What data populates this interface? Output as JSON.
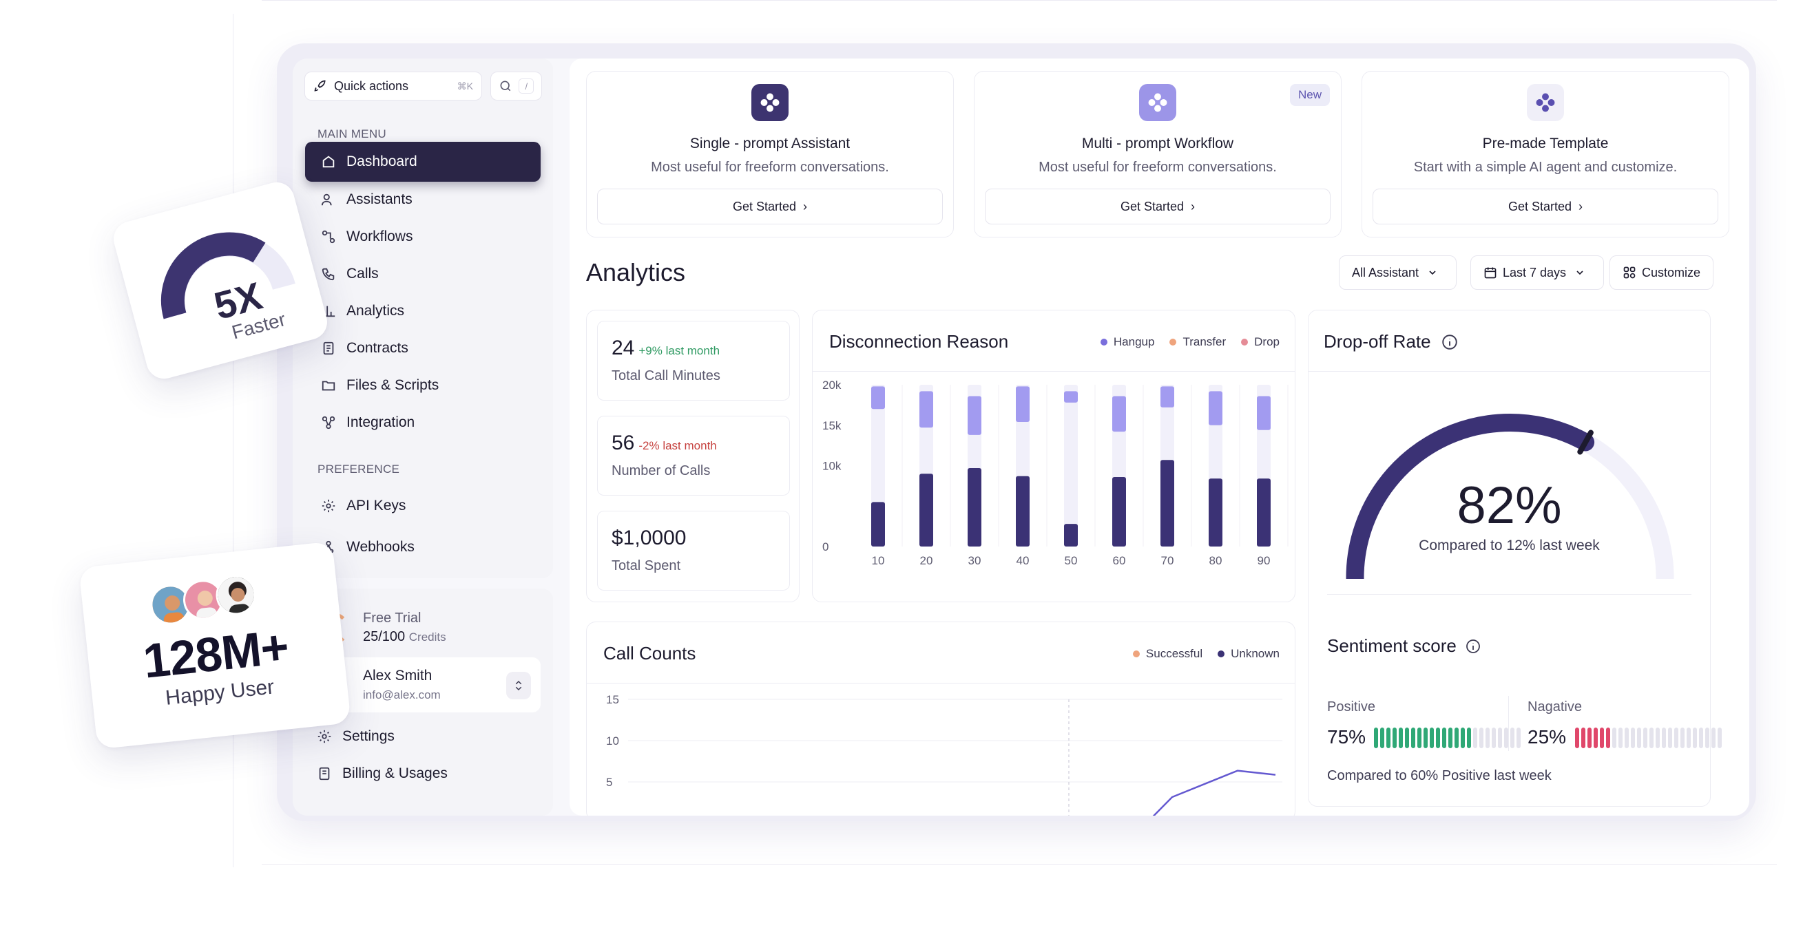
{
  "quick_actions": {
    "label": "Quick actions",
    "shortcut": "⌘K",
    "search_shortcut": "/"
  },
  "sidebar": {
    "main_menu_label": "MAIN MENU",
    "items": [
      {
        "label": "Dashboard",
        "icon": "home-icon",
        "active": true
      },
      {
        "label": "Assistants",
        "icon": "users-icon"
      },
      {
        "label": "Workflows",
        "icon": "workflow-icon"
      },
      {
        "label": "Calls",
        "icon": "phone-icon"
      },
      {
        "label": "Analytics",
        "icon": "chart-icon"
      },
      {
        "label": "Contracts",
        "icon": "contract-icon"
      },
      {
        "label": "Files & Scripts",
        "icon": "folder-icon"
      },
      {
        "label": "Integration",
        "icon": "integration-icon"
      }
    ],
    "preference_label": "PREFERENCE",
    "pref_items": [
      {
        "label": "API Keys",
        "icon": "key-icon"
      },
      {
        "label": "Webhooks",
        "icon": "webhook-icon"
      }
    ],
    "trial": {
      "title": "Free Trial",
      "credits_used": "25",
      "credits_total": "/100",
      "credits_unit": "Credits"
    },
    "user": {
      "name": "Alex Smith",
      "email": "info@alex.com"
    },
    "bottom_items": [
      {
        "label": "Settings",
        "icon": "gear-icon"
      },
      {
        "label": "Billing & Usages",
        "icon": "billing-icon"
      }
    ]
  },
  "templates": [
    {
      "title": "Single - prompt Assistant",
      "desc": "Most useful for freeform conversations.",
      "button": "Get Started",
      "icon_color": "#3d3470",
      "badge": ""
    },
    {
      "title": "Multi - prompt Workflow",
      "desc": "Most useful for freeform conversations.",
      "button": "Get Started",
      "icon_color": "#9c95e8",
      "badge": "New"
    },
    {
      "title": "Pre-made Template",
      "desc": "Start with a simple AI agent and customize.",
      "button": "Get Started",
      "icon_color": "#f0eff8",
      "badge": ""
    }
  ],
  "analytics": {
    "title": "Analytics",
    "filters": {
      "assistant": "All Assistant",
      "range": "Last 7 days",
      "customize": "Customize"
    }
  },
  "stats": [
    {
      "value": "24",
      "change": "+9% last month",
      "direction": "up",
      "label": "Total Call Minutes"
    },
    {
      "value": "56",
      "change": "-2% last month",
      "direction": "down",
      "label": "Number of Calls"
    },
    {
      "value": "$1,0000",
      "change": "",
      "direction": "",
      "label": "Total Spent"
    }
  ],
  "disconnection": {
    "title": "Disconnection Reason",
    "legend": [
      {
        "name": "Hangup",
        "color": "#7a6fdc"
      },
      {
        "name": "Transfer",
        "color": "#efa47d"
      },
      {
        "name": "Drop",
        "color": "#e58c97"
      }
    ]
  },
  "call_counts": {
    "title": "Call Counts",
    "legend": [
      {
        "name": "Successful",
        "color": "#efa47d"
      },
      {
        "name": "Unknown",
        "color": "#3b3275"
      }
    ]
  },
  "dropoff": {
    "title": "Drop-off Rate",
    "percent_label": "82%",
    "value": 0.82,
    "subtitle": "Compared to 12% last week"
  },
  "sentiment": {
    "title": "Sentiment score",
    "positive_label": "Positive",
    "positive_value": "75%",
    "positive_fraction": 0.75,
    "negative_label": "Nagative",
    "negative_value": "25%",
    "negative_fraction": 0.25,
    "footer": "Compared to 60% Positive last week"
  },
  "floating": {
    "speed_value": "5X",
    "speed_label": "Faster",
    "users_value": "128M+",
    "users_label": "Happy User"
  },
  "colors": {
    "primary": "#2a2546",
    "accent": "#7a6fdc",
    "light_accent": "#a29bf0",
    "track": "#f0eff8"
  },
  "chart_data": [
    {
      "type": "bar",
      "title": "Disconnection Reason",
      "categories": [
        "10",
        "20",
        "30",
        "40",
        "50",
        "60",
        "70",
        "80",
        "90"
      ],
      "ylim": [
        0,
        20000
      ],
      "yticks": [
        "0",
        "10k",
        "15k",
        "20k"
      ],
      "series": [
        {
          "name": "Hangup",
          "values": [
            5500,
            9000,
            9700,
            8700,
            2800,
            8600,
            10700,
            8400,
            8400
          ]
        },
        {
          "name": "Transfer",
          "values": [
            2800,
            4500,
            4800,
            4400,
            1400,
            4400,
            2600,
            4200,
            4200
          ]
        }
      ]
    },
    {
      "type": "line",
      "title": "Call Counts",
      "ylim": [
        0,
        15
      ],
      "yticks": [
        "5",
        "10",
        "15"
      ],
      "series": [
        {
          "name": "Unknown",
          "x": [
            0,
            1,
            2,
            3
          ],
          "values": [
            0,
            4.5,
            7.7,
            7.2
          ]
        }
      ]
    }
  ]
}
